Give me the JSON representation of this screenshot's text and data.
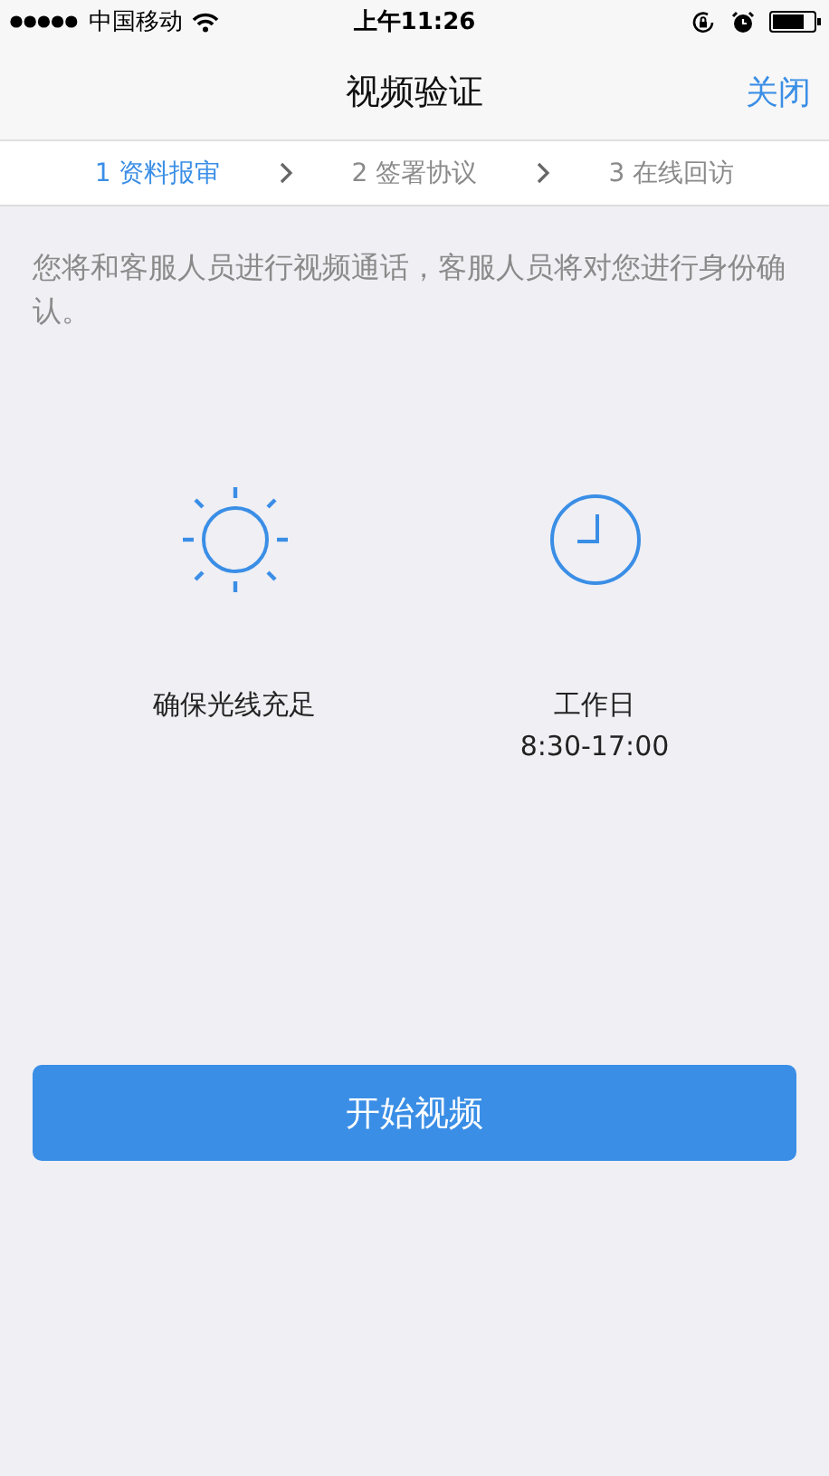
{
  "status_bar": {
    "carrier": "中国移动",
    "time": "上午11:26"
  },
  "nav": {
    "title": "视频验证",
    "close": "关闭"
  },
  "steps": [
    {
      "label": "1 资料报审",
      "selected": true
    },
    {
      "label": "2 签署协议",
      "selected": false
    },
    {
      "label": "3 在线回访",
      "selected": false
    }
  ],
  "intro": "您将和客服人员进行视频通话，客服人员将对您进行身份确认。",
  "tips": [
    {
      "kind": "sun",
      "lines": [
        "确保光线充足"
      ]
    },
    {
      "kind": "clock",
      "lines": [
        "工作日",
        "8:30-17:00"
      ]
    }
  ],
  "start_button": "开始视频"
}
